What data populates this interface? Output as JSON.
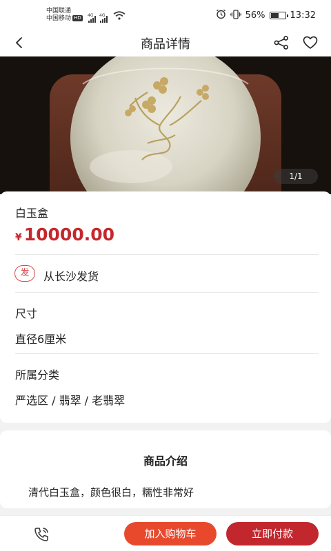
{
  "status_bar": {
    "carrier_1": "中国联通",
    "carrier_2": "中国移动",
    "hd_badge": "HD",
    "network_1": "4G",
    "network_2": "4G",
    "battery_percent": "56%",
    "battery_level": 0.56,
    "time": "13:32",
    "icons": [
      "alarm-icon",
      "vibrate-icon",
      "wifi-icon",
      "battery-icon"
    ]
  },
  "header": {
    "title": "商品详情",
    "back_icon": "chevron-left-icon",
    "share_icon": "share-icon",
    "favorite_icon": "heart-icon"
  },
  "gallery": {
    "pager": "1/1"
  },
  "product": {
    "name": "白玉盒",
    "currency": "¥",
    "price": "10000.00",
    "ship_badge": "发",
    "ship_text": "从长沙发货",
    "size_label": "尺寸",
    "size_value": "直径6厘米",
    "category_label": "所属分类",
    "category_value": "严选区 / 翡翠 / 老翡翠"
  },
  "intro": {
    "title": "商品介绍",
    "text": "清代白玉盒，颜色很白，糯性非常好"
  },
  "bottom": {
    "phone_icon": "phone-icon",
    "add_to_cart": "加入购物车",
    "buy_now": "立即付款"
  },
  "colors": {
    "price_red": "#c6272c",
    "cart_orange": "#e8492d",
    "buy_red": "#c1272d"
  }
}
